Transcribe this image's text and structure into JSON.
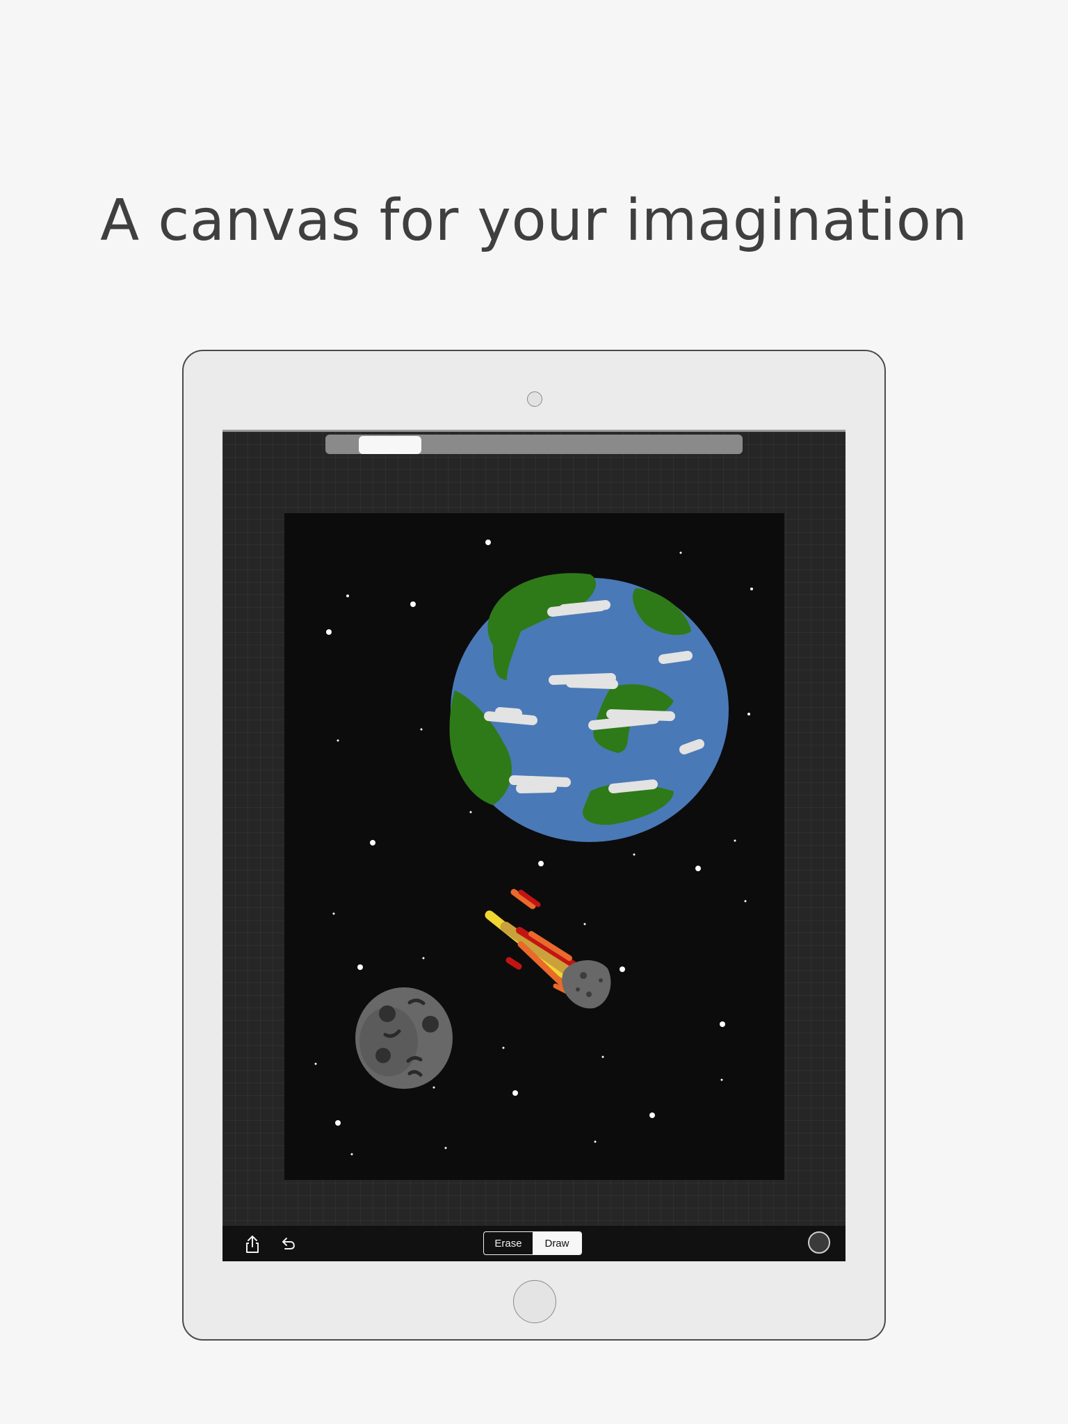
{
  "headline": "A canvas for your imagination",
  "device": {
    "camera_icon": "camera-icon",
    "home_button_icon": "home-button"
  },
  "app": {
    "scrollbar": {
      "position_fraction": 0.1
    },
    "toolbar": {
      "share_icon": "share-icon",
      "undo_icon": "undo-icon",
      "mode_options": [
        "Erase",
        "Draw"
      ],
      "erase_label": "Erase",
      "draw_label": "Draw",
      "selected_mode": "Draw",
      "color_swatch": "#3a3a3a"
    },
    "canvas": {
      "background": "#0c0c0c",
      "drawing_elements": [
        "stars",
        "earth",
        "comet",
        "asteroid"
      ],
      "colors": {
        "ocean": "#4a79b7",
        "land": "#2e7a18",
        "clouds": "#e3e3e3",
        "asteroid": "#686868",
        "comet_yellow": "#f0d631",
        "comet_orange": "#ea6a2c",
        "comet_red": "#c31414"
      }
    }
  }
}
